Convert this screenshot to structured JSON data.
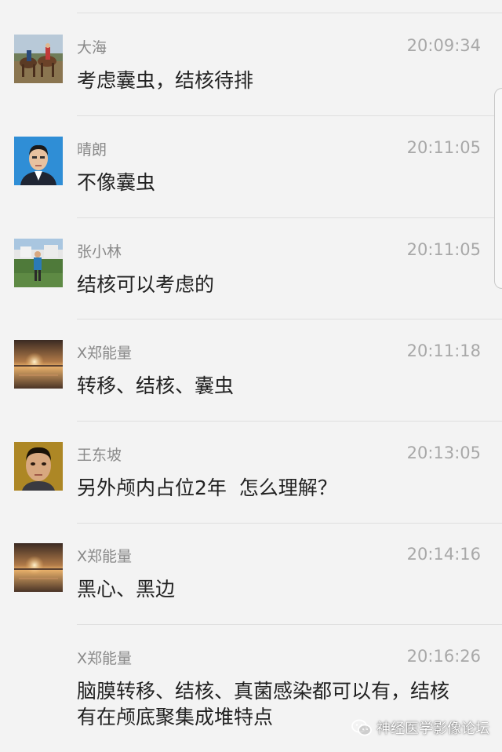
{
  "messages": [
    {
      "sender": "大海",
      "time": "20:09:34",
      "text": "考虑囊虫，结核待排",
      "avatar": "horse-riders-avatar"
    },
    {
      "sender": "晴朗",
      "time": "20:11:05",
      "text": "不像囊虫",
      "avatar": "portrait-photo-avatar"
    },
    {
      "sender": "张小林",
      "time": "20:11:05",
      "text": "结核可以考虑的",
      "avatar": "outdoor-person-avatar"
    },
    {
      "sender": "X郑能量",
      "time": "20:11:18",
      "text": "转移、结核、囊虫",
      "avatar": "sunset-avatar"
    },
    {
      "sender": "王东坡",
      "time": "20:13:05",
      "text": "另外颅内占位2年  怎么理解？",
      "avatar": "face-photo-avatar"
    },
    {
      "sender": "X郑能量",
      "time": "20:14:16",
      "text": "黑心、黑边",
      "avatar": "sunset-avatar"
    },
    {
      "sender": "X郑能量",
      "time": "20:16:26",
      "text_lines": [
        "脑膜转移、结核、真菌感染都可以有，结核",
        "有在颅底聚集成堆特点"
      ],
      "avatar": null
    }
  ],
  "watermark": {
    "text": "神经医学影像论坛",
    "icon": "wechat-icon"
  },
  "colors": {
    "background": "#f3f3f3",
    "name": "#8a8a8a",
    "time": "#a8a8a8",
    "text": "#222222",
    "divider": "#dedede"
  }
}
